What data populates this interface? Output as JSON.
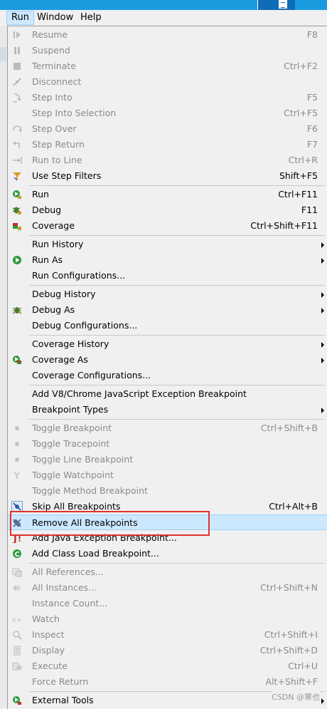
{
  "menubar": {
    "items": [
      {
        "label": "Run",
        "active": true
      },
      {
        "label": "Window",
        "active": false
      },
      {
        "label": "Help",
        "active": false
      }
    ]
  },
  "menu_items": [
    {
      "label": "Resume",
      "accel": "F8",
      "enabled": false,
      "icon": "resume-icon"
    },
    {
      "label": "Suspend",
      "accel": "",
      "enabled": false,
      "icon": "suspend-icon"
    },
    {
      "label": "Terminate",
      "accel": "Ctrl+F2",
      "enabled": false,
      "icon": "terminate-icon"
    },
    {
      "label": "Disconnect",
      "accel": "",
      "enabled": false,
      "icon": "disconnect-icon"
    },
    {
      "label": "Step Into",
      "accel": "F5",
      "enabled": false,
      "icon": "step-into-icon"
    },
    {
      "label": "Step Into Selection",
      "accel": "Ctrl+F5",
      "enabled": false,
      "icon": ""
    },
    {
      "label": "Step Over",
      "accel": "F6",
      "enabled": false,
      "icon": "step-over-icon"
    },
    {
      "label": "Step Return",
      "accel": "F7",
      "enabled": false,
      "icon": "step-return-icon"
    },
    {
      "label": "Run to Line",
      "accel": "Ctrl+R",
      "enabled": false,
      "icon": "run-to-line-icon"
    },
    {
      "label": "Use Step Filters",
      "accel": "Shift+F5",
      "enabled": true,
      "icon": "step-filters-icon"
    },
    {
      "label": "Run",
      "accel": "Ctrl+F11",
      "enabled": true,
      "icon": "run-icon"
    },
    {
      "label": "Debug",
      "accel": "F11",
      "enabled": true,
      "icon": "debug-icon"
    },
    {
      "label": "Coverage",
      "accel": "Ctrl+Shift+F11",
      "enabled": true,
      "icon": "coverage-icon"
    },
    {
      "label": "Run History",
      "accel": "",
      "enabled": true,
      "submenu": true,
      "icon": ""
    },
    {
      "label": "Run As",
      "accel": "",
      "enabled": true,
      "submenu": true,
      "icon": "run-as-icon"
    },
    {
      "label": "Run Configurations...",
      "accel": "",
      "enabled": true,
      "icon": ""
    },
    {
      "label": "Debug History",
      "accel": "",
      "enabled": true,
      "submenu": true,
      "icon": ""
    },
    {
      "label": "Debug As",
      "accel": "",
      "enabled": true,
      "submenu": true,
      "icon": "bug-icon"
    },
    {
      "label": "Debug Configurations...",
      "accel": "",
      "enabled": true,
      "icon": ""
    },
    {
      "label": "Coverage History",
      "accel": "",
      "enabled": true,
      "submenu": true,
      "icon": ""
    },
    {
      "label": "Coverage As",
      "accel": "",
      "enabled": true,
      "submenu": true,
      "icon": "coverage-as-icon"
    },
    {
      "label": "Coverage Configurations...",
      "accel": "",
      "enabled": true,
      "icon": ""
    },
    {
      "label": "Add V8/Chrome JavaScript Exception Breakpoint",
      "accel": "",
      "enabled": true,
      "icon": ""
    },
    {
      "label": "Breakpoint Types",
      "accel": "",
      "enabled": true,
      "submenu": true,
      "icon": ""
    },
    {
      "label": "Toggle Breakpoint",
      "accel": "Ctrl+Shift+B",
      "enabled": false,
      "icon": "breakpoint-dot-icon"
    },
    {
      "label": "Toggle Tracepoint",
      "accel": "",
      "enabled": false,
      "icon": "tracepoint-dot-icon"
    },
    {
      "label": "Toggle Line Breakpoint",
      "accel": "",
      "enabled": false,
      "icon": "line-breakpoint-dot-icon"
    },
    {
      "label": "Toggle Watchpoint",
      "accel": "",
      "enabled": false,
      "icon": "watchpoint-icon"
    },
    {
      "label": "Toggle Method Breakpoint",
      "accel": "",
      "enabled": false,
      "icon": ""
    },
    {
      "label": "Skip All Breakpoints",
      "accel": "Ctrl+Alt+B",
      "enabled": true,
      "icon": "skip-breakpoints-icon"
    },
    {
      "label": "Remove All Breakpoints",
      "accel": "",
      "enabled": true,
      "highlighted": true,
      "icon": "remove-breakpoints-icon"
    },
    {
      "label": "Add Java Exception Breakpoint...",
      "accel": "",
      "enabled": true,
      "icon": "exception-breakpoint-icon"
    },
    {
      "label": "Add Class Load Breakpoint...",
      "accel": "",
      "enabled": true,
      "icon": "class-load-icon"
    },
    {
      "label": "All References...",
      "accel": "",
      "enabled": false,
      "icon": "references-icon"
    },
    {
      "label": "All Instances...",
      "accel": "Ctrl+Shift+N",
      "enabled": false,
      "icon": "instances-icon"
    },
    {
      "label": "Instance Count...",
      "accel": "",
      "enabled": false,
      "icon": ""
    },
    {
      "label": "Watch",
      "accel": "",
      "enabled": false,
      "icon": "watch-icon"
    },
    {
      "label": "Inspect",
      "accel": "Ctrl+Shift+I",
      "enabled": false,
      "icon": "inspect-icon"
    },
    {
      "label": "Display",
      "accel": "Ctrl+Shift+D",
      "enabled": false,
      "icon": "display-icon"
    },
    {
      "label": "Execute",
      "accel": "Ctrl+U",
      "enabled": false,
      "icon": "execute-icon"
    },
    {
      "label": "Force Return",
      "accel": "Alt+Shift+F",
      "enabled": false,
      "icon": ""
    },
    {
      "label": "External Tools",
      "accel": "",
      "enabled": true,
      "submenu": true,
      "icon": "external-tools-icon"
    }
  ],
  "watermark": "CSDN @寒也"
}
